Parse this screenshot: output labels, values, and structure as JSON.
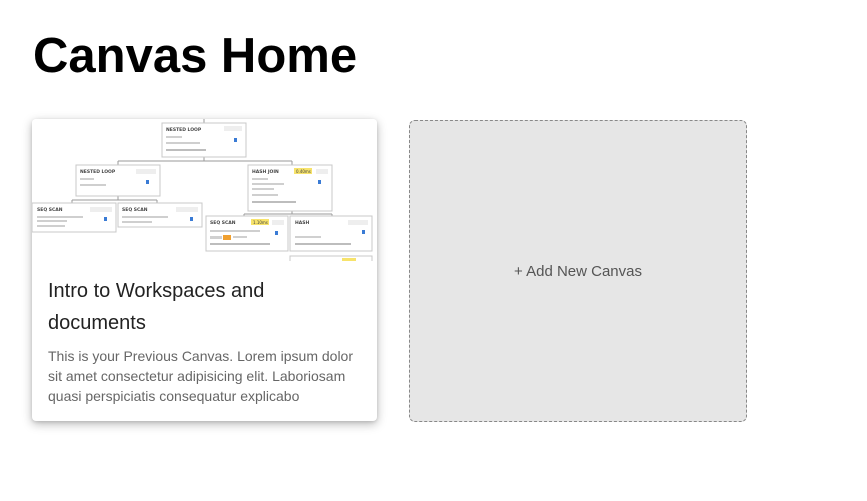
{
  "page": {
    "title": "Canvas Home"
  },
  "canvas_card": {
    "title": "Intro to Workspaces and documents",
    "description": "This is your Previous Canvas. Lorem ipsum dolor sit amet consectetur adipisicing elit. Laboriosam quasi perspiciatis consequatur explicabo",
    "thumbnail": {
      "nodes": [
        {
          "label": "NESTED LOOP"
        },
        {
          "label": "NESTED LOOP"
        },
        {
          "label": "HASH JOIN",
          "badge": "0.40ms"
        },
        {
          "label": "SEQ SCAN"
        },
        {
          "label": "SEQ SCAN"
        },
        {
          "label": "SEQ SCAN",
          "badge": "1.10ms"
        },
        {
          "label": "HASH"
        }
      ]
    }
  },
  "add_card": {
    "label": "+ Add New Canvas"
  },
  "colors": {
    "badge_yellow": "#f7e36b",
    "badge_orange": "#f0a030",
    "icon_blue": "#3a7bd5",
    "add_card_bg": "#e6e6e6"
  }
}
